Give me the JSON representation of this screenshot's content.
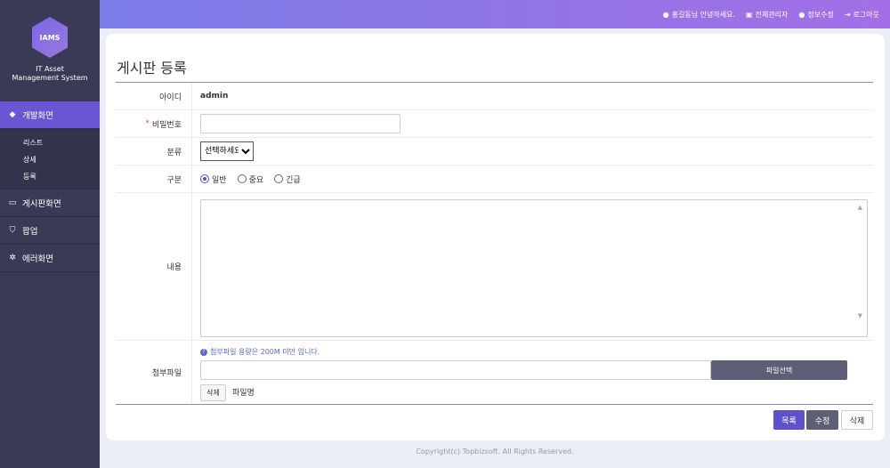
{
  "sidebar": {
    "logo": "IAMS",
    "logo_line1": "IT Asset",
    "logo_line2": "Management System",
    "menu": [
      {
        "label": "개발화면",
        "icon": "diamond-icon"
      },
      {
        "label": "게시판화면",
        "icon": "monitor-icon"
      },
      {
        "label": "팝업",
        "icon": "shield-icon"
      },
      {
        "label": "에러화면",
        "icon": "gear-icon"
      }
    ],
    "submenu": [
      "리스트",
      "상세",
      "등록"
    ]
  },
  "topbar": {
    "greeting": "홍길동님 안녕하세요.",
    "admin": "전체관리자",
    "profile": "정보수정",
    "logout": "로그아웃"
  },
  "form": {
    "title": "게시판 등록",
    "id_label": "아이디",
    "id_value": "admin",
    "password_label": "비밀번호",
    "category_label": "분류",
    "category_selected": "선택하세요",
    "type_label": "구분",
    "type_options": [
      "일반",
      "중요",
      "긴급"
    ],
    "type_selected": "일반",
    "content_label": "내용",
    "attach_label": "첨부파일",
    "attach_note": "첨부파일 용량은 200M 미만 입니다.",
    "file_select_button": "파일선택",
    "file_delete_button": "삭제",
    "file_name": "파일명"
  },
  "actions": {
    "list": "목록",
    "edit": "수정",
    "delete": "삭제"
  },
  "footer": "Copyright(c) Topbizsoft. All Rights Reserved.",
  "colors": {
    "accent": "#5d52c9",
    "sidebar": "#3b3a56",
    "dark_button": "#5e5e76"
  }
}
